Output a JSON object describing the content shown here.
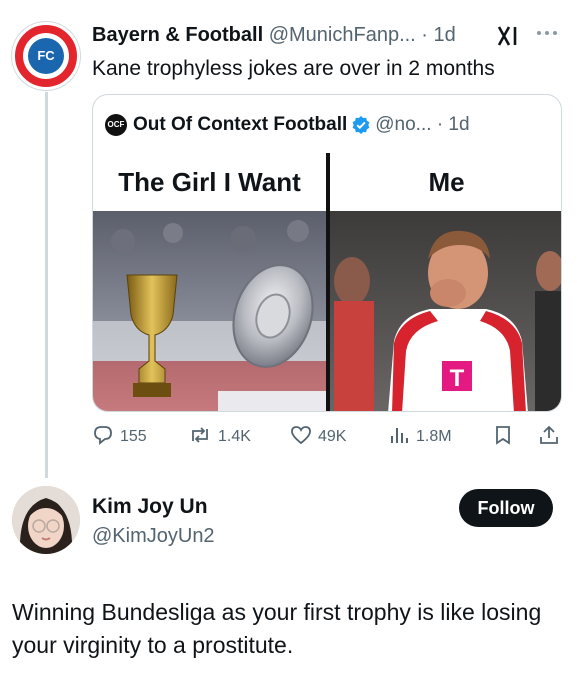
{
  "tweet": {
    "author_name": "Bayern & Football",
    "author_handle": "@MunichFanp...",
    "separator": "·",
    "time": "1d",
    "text": "Kane trophyless jokes are over in 2 months",
    "avatar_text": "FC"
  },
  "quote": {
    "author_name": "Out Of Context Football",
    "author_handle": "@no...",
    "separator": "·",
    "time": "1d",
    "avatar_text": "OCF",
    "meme": {
      "left_caption": "The Girl I Want",
      "right_caption": "Me"
    }
  },
  "actions": {
    "replies": "155",
    "reposts": "1.4K",
    "likes": "49K",
    "views": "1.8M"
  },
  "reply": {
    "author_name": "Kim Joy Un",
    "author_handle": "@KimJoyUn2",
    "follow_label": "Follow",
    "text": "Winning Bundesliga as your first trophy is like losing your virginity to a prostitute."
  },
  "icons": {
    "reply": "speech-bubble-icon",
    "repost": "repost-arrows-icon",
    "like": "heart-icon",
    "views": "bar-chart-icon",
    "bookmark": "bookmark-icon",
    "share": "share-icon",
    "verified": "verified-badge-icon",
    "more": "more-dots-icon",
    "grok": "grok-icon"
  },
  "colors": {
    "text": "#0f1419",
    "secondary": "#536471",
    "verified": "#1d9bf0",
    "follow_bg": "#0f1419"
  }
}
